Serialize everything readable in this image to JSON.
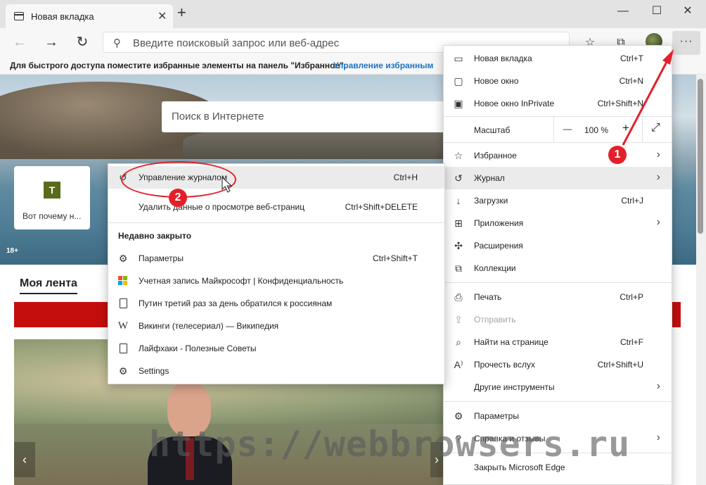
{
  "browser": {
    "tab": {
      "title": "Новая вкладка"
    },
    "address_placeholder": "Введите поисковый запрос или веб-адрес",
    "favorites_bar": {
      "text": "Для быстрого доступа поместите избранные элементы на панель \"Избранное\".",
      "link": "Управление избранным"
    },
    "more_label": "···"
  },
  "page": {
    "search_placeholder": "Поиск в Интернете",
    "tile": {
      "logo": "T",
      "label": "Вот почему н..."
    },
    "age_badge": "18+",
    "feed_title": "Моя лента"
  },
  "main_menu": {
    "items": [
      {
        "icon": "new-tab-icon",
        "label": "Новая вкладка",
        "shortcut": "Ctrl+T"
      },
      {
        "icon": "new-window-icon",
        "label": "Новое окно",
        "shortcut": "Ctrl+N"
      },
      {
        "icon": "inprivate-icon",
        "label": "Новое окно InPrivate",
        "shortcut": "Ctrl+Shift+N"
      },
      {
        "label": "Масштаб",
        "zoom_value": "100 %",
        "zoom_minus": "—",
        "zoom_plus": "+"
      },
      {
        "icon": "favorites-icon",
        "label": "Избранное"
      },
      {
        "icon": "history-icon",
        "label": "Журнал",
        "highlighted": true
      },
      {
        "icon": "downloads-icon",
        "label": "Загрузки",
        "shortcut": "Ctrl+J"
      },
      {
        "icon": "apps-icon",
        "label": "Приложения"
      },
      {
        "icon": "extensions-icon",
        "label": "Расширения"
      },
      {
        "icon": "collections-icon",
        "label": "Коллекции"
      },
      {
        "icon": "print-icon",
        "label": "Печать",
        "shortcut": "Ctrl+P"
      },
      {
        "icon": "share-icon",
        "label": "Отправить",
        "disabled": true
      },
      {
        "icon": "find-icon",
        "label": "Найти на странице",
        "shortcut": "Ctrl+F"
      },
      {
        "icon": "read-aloud-icon",
        "label": "Прочесть вслух",
        "shortcut": "Ctrl+Shift+U"
      },
      {
        "label": "Другие инструменты"
      },
      {
        "icon": "settings-icon",
        "label": "Параметры"
      },
      {
        "icon": "help-icon",
        "label": "Справка и отзывы"
      },
      {
        "label": "Закрыть Microsoft Edge"
      }
    ]
  },
  "history_menu": {
    "manage": {
      "label": "Управление журналом",
      "shortcut": "Ctrl+H"
    },
    "clear": {
      "label": "Удалить данные о просмотре веб-страниц",
      "shortcut": "Ctrl+Shift+DELETE"
    },
    "recently_closed_heading": "Недавно закрыто",
    "recent": [
      {
        "icon": "settings-icon",
        "label": "Параметры",
        "shortcut": "Ctrl+Shift+T"
      },
      {
        "icon": "microsoft-logo-icon",
        "label": "Учетная запись Майкрософт | Конфиденциальность"
      },
      {
        "icon": "page-icon",
        "label": "Путин третий раз за день обратился к россиянам"
      },
      {
        "icon": "wikipedia-icon",
        "label": "Викинги (телесериал) — Википедия",
        "glyph": "W"
      },
      {
        "icon": "page-icon",
        "label": "Лайфхаки - Полезные Советы"
      },
      {
        "icon": "settings-icon",
        "label": "Settings"
      }
    ]
  },
  "annotations": {
    "badge1": "1",
    "badge2": "2",
    "watermark": "https://webbrowsers.ru"
  },
  "colors": {
    "accent_red": "#e3202a",
    "banner_red": "#c40e0e",
    "link_blue": "#1a73c8"
  }
}
